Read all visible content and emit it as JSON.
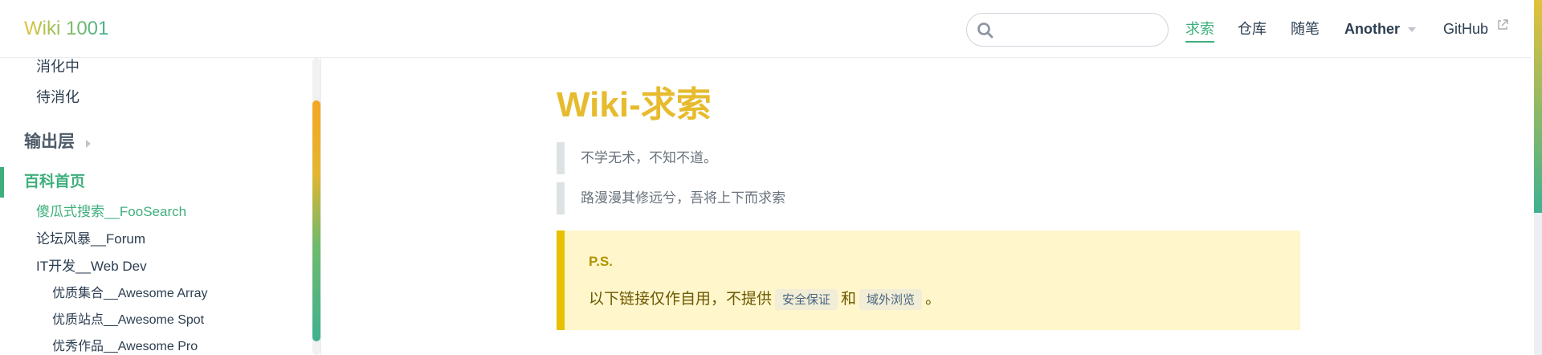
{
  "navbar": {
    "brand": "Wiki 1001",
    "search": {
      "value": "",
      "placeholder": ""
    },
    "links": [
      {
        "label": "求索",
        "active": true
      },
      {
        "label": "仓库"
      },
      {
        "label": "随笔"
      },
      {
        "label": "Another",
        "dropdown": true
      },
      {
        "label": "GitHub",
        "external": true
      }
    ],
    "icons": {
      "search": "search-icon",
      "external": "external-link-icon",
      "dropdown": "chevron-down-icon"
    },
    "accent_color": "#3eaf7c"
  },
  "sidebar": {
    "items": [
      {
        "label": "消化中"
      },
      {
        "label": "待消化"
      },
      {
        "label": "输出层",
        "collapsed": true
      },
      {
        "label": "百科首页",
        "active": true
      },
      {
        "label": "傻瓜式搜索__FooSearch",
        "active": true
      },
      {
        "label": "论坛风暴__Forum"
      },
      {
        "label": "IT开发__Web Dev"
      },
      {
        "label": "优质集合__Awesome Array"
      },
      {
        "label": "优质站点__Awesome Spot"
      },
      {
        "label": "优秀作品__Awesome Pro"
      }
    ]
  },
  "main": {
    "title": "Wiki-求索",
    "quotes": [
      "不学无术，不知不道。",
      "路漫漫其修远兮，吾将上下而求索"
    ],
    "tip": {
      "title": "P.S.",
      "text_before": "以下链接仅作自用，不提供",
      "code1": "安全保证",
      "text_mid": "和",
      "code2": "域外浏览",
      "text_after": "。"
    },
    "title_color": "#e6bb2e",
    "tip_border_color": "#e7c000"
  }
}
